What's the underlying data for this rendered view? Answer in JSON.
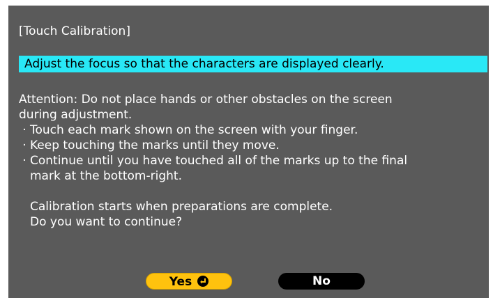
{
  "dialog": {
    "title": "[Touch Calibration]",
    "banner": "Adjust the focus so that the characters are displayed clearly.",
    "attention_line1": "Attention: Do not place hands or other obstacles on the screen",
    "attention_line2": "during adjustment.",
    "bullet_char": "·",
    "bullets": [
      {
        "line1": "Touch each mark shown on the screen with your finger."
      },
      {
        "line1": "Keep touching the marks until they move."
      },
      {
        "line1": "Continue until you have touched all of the marks up to the final",
        "line2": "mark at the bottom-right."
      }
    ],
    "confirm_line1": "Calibration starts when preparations are complete.",
    "confirm_line2": "Do you want to continue?"
  },
  "buttons": {
    "yes_label": "Yes",
    "yes_icon": "enter-icon",
    "no_label": "No"
  },
  "colors": {
    "dialog_bg": "#5a5a5a",
    "banner_bg": "#29e8f6",
    "yes_bg": "#ffc20e",
    "no_bg": "#000000"
  }
}
